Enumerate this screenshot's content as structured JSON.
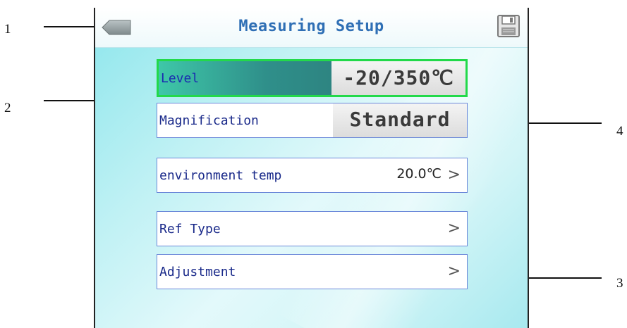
{
  "callouts": [
    "1",
    "2",
    "3",
    "4"
  ],
  "titlebar": {
    "back_icon": "back-arrow-icon",
    "title": "Measuring Setup",
    "save_icon": "floppy-save-icon"
  },
  "rows": [
    {
      "label": "Level",
      "value": "-20/350℃",
      "selected": true
    },
    {
      "label": "Magnification",
      "value": "Standard"
    },
    {
      "label": "environment temp",
      "value": "20.0℃",
      "chevron": ">"
    },
    {
      "label": "Ref Type",
      "chevron": ">"
    },
    {
      "label": "Adjustment",
      "chevron": ">"
    }
  ],
  "colors": {
    "title": "#2f6fb5",
    "selected_border": "#22d94a",
    "row_border": "#6b88d9",
    "label_text": "#1a2a8a"
  }
}
